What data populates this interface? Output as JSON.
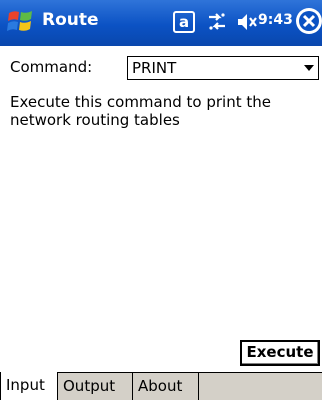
{
  "window": {
    "title": "Route",
    "tray": {
      "a_label": "a",
      "time": "9:43",
      "connectivity_icon": "connectivity-icon",
      "speaker_icon": "speaker-muted-icon",
      "close_icon": "close-icon"
    }
  },
  "command": {
    "label": "Command:",
    "selected": "PRINT"
  },
  "description": "Execute this command to print the network routing tables",
  "actions": {
    "execute_label": "Execute"
  },
  "tabs": [
    {
      "label": "Input",
      "active": true
    },
    {
      "label": "Output",
      "active": false
    },
    {
      "label": "About",
      "active": false
    }
  ],
  "colors": {
    "titlebar": "#0b52c4",
    "tabbar": "#d4d0c8"
  }
}
